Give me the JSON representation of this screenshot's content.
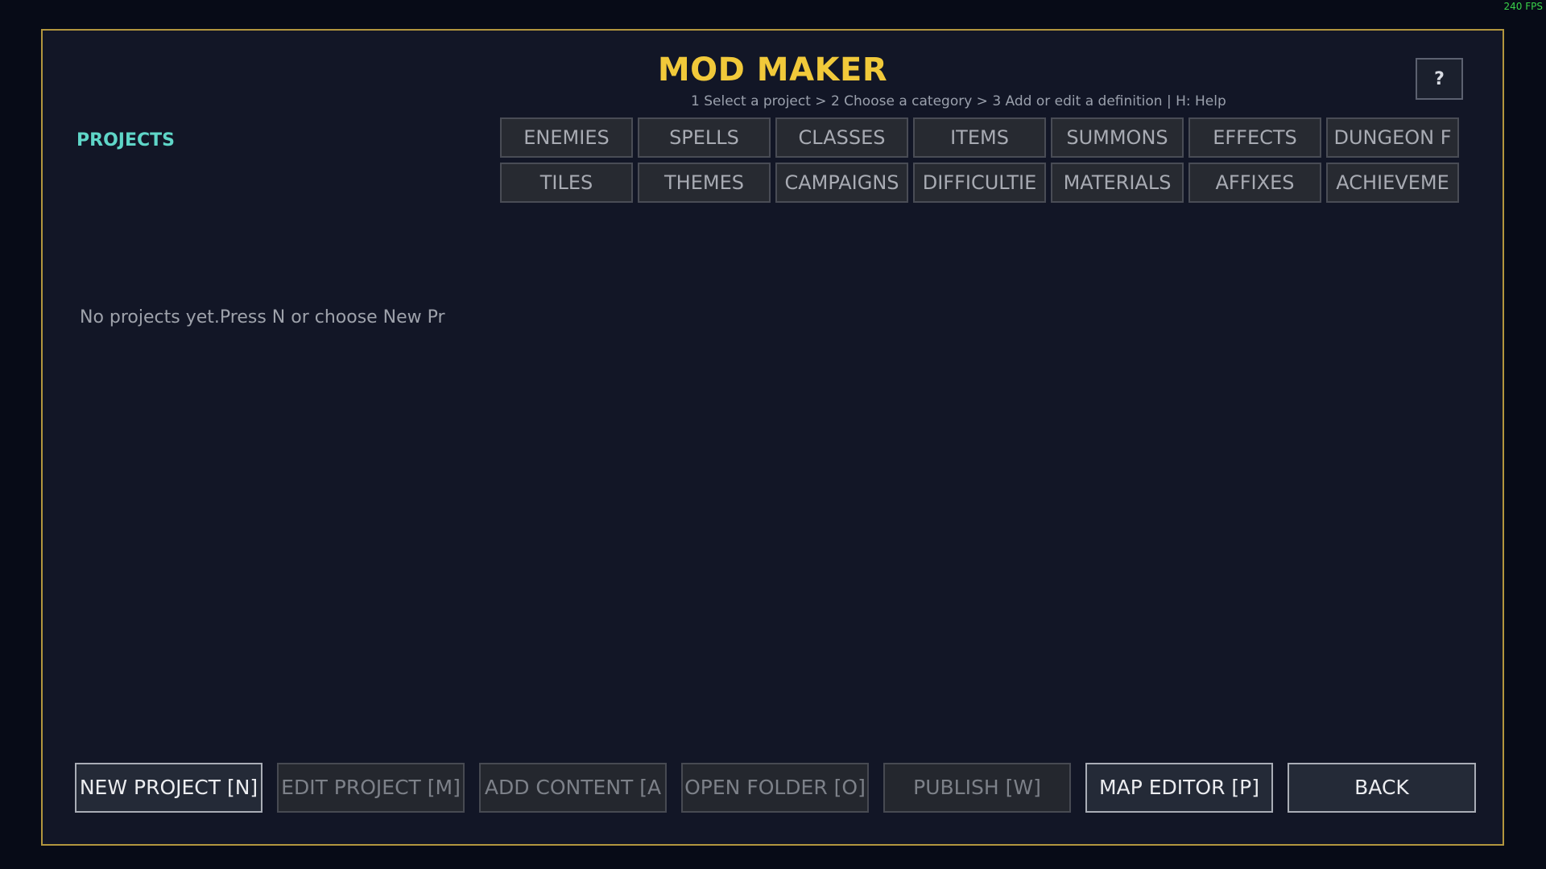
{
  "overlay": {
    "fps": "240 FPS"
  },
  "header": {
    "title": "MOD MAKER",
    "steps": "1 Select a project  >  2 Choose a category  >  3 Add or edit a definition  |  H: Help",
    "help_label": "?"
  },
  "projects": {
    "heading": "PROJECTS",
    "empty_message": "No projects yet.Press N or choose New Pr"
  },
  "categories": [
    {
      "label": "ENEMIES"
    },
    {
      "label": "SPELLS"
    },
    {
      "label": "CLASSES"
    },
    {
      "label": "ITEMS"
    },
    {
      "label": "SUMMONS"
    },
    {
      "label": "EFFECTS"
    },
    {
      "label": "DUNGEON F"
    },
    {
      "label": "TILES"
    },
    {
      "label": "THEMES"
    },
    {
      "label": "CAMPAIGNS"
    },
    {
      "label": "DIFFICULTIE"
    },
    {
      "label": "MATERIALS"
    },
    {
      "label": "AFFIXES"
    },
    {
      "label": "ACHIEVEME"
    }
  ],
  "actions": {
    "new_project": "NEW PROJECT [N]",
    "edit_project": "EDIT PROJECT [M]",
    "add_content": "ADD CONTENT [A",
    "open_folder": "OPEN FOLDER [O]",
    "publish": "PUBLISH [W]",
    "map_editor": "MAP EDITOR [P]",
    "back": "BACK"
  },
  "colors": {
    "accent_title": "#f1c93a",
    "panel_border": "#b2963e",
    "projects_heading": "#5fd6c8",
    "background": "#121626"
  }
}
